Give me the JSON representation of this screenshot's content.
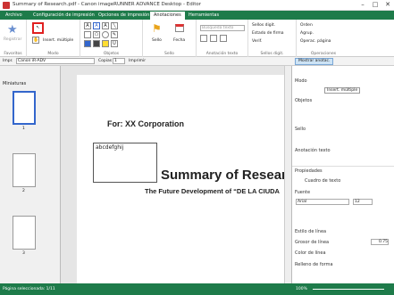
{
  "window": {
    "title": "Summary of Research.pdf - Canon imageRUNNER ADVANCE Desktop - Editor"
  },
  "tabs": [
    "Archivo",
    "Configuración de impresión",
    "Opciones de impresión",
    "Anotaciones",
    "Herramientas"
  ],
  "ribbon": {
    "register_label": "Registrar",
    "multi_insert_label": "Insert. múltiple",
    "stamp_label": "Sello",
    "date_label": "Fecha",
    "text_search_placeholder": "Búsqueda texto",
    "digital_stamps_label": "Sellos digit.",
    "signature_status_label": "Estado de firma",
    "verify_label": "Verif.",
    "order_label": "Orden",
    "group_label": "Agrup.",
    "page_ops_label": "Operac. página",
    "groups": {
      "favorites": "Favoritos",
      "mode": "Modo",
      "objects": "Objetos",
      "stamp": "Sello",
      "text_annotation": "Anotación texto",
      "digital_stamps": "Sellos digit.",
      "operations": "Operaciones"
    }
  },
  "toolbar2": {
    "print_label": "Impr.",
    "printer": "Canon iR-ADV",
    "copies_label": "Copias",
    "copies": "1",
    "print_button": "Imprimir",
    "show_annotations": "Mostrar anotac."
  },
  "thumbnails": {
    "header": "Miniaturas",
    "pages": [
      "1",
      "2",
      "3"
    ]
  },
  "document": {
    "corp": "For: XX Corporation",
    "textbox": "abcdefghij",
    "title": "Summary of Researc",
    "subtitle": "The Future Development of “DE LA CIUDA"
  },
  "rightpane": {
    "mode": "Modo",
    "multi_insert": "Insert. múltiple",
    "objects": "Objetos",
    "stamp": "Sello",
    "text_annotation": "Anotación texto",
    "properties": "Propiedades",
    "textbox_label": "Cuadro de texto",
    "font_label": "Fuente",
    "font_name": "Arial",
    "font_size": "12",
    "line_style": "Estilo de línea",
    "line_width": "Grosor de línea",
    "line_width_value": "0.75",
    "line_color": "Color de línea",
    "fill_color": "Relleno de forma"
  },
  "status": {
    "page": "Página seleccionada: 1/11",
    "zoom": "100%"
  }
}
